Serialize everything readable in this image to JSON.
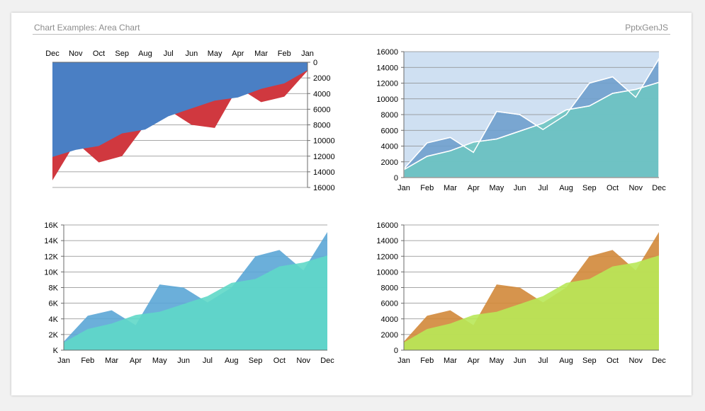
{
  "header": {
    "title": "Chart Examples: Area Chart",
    "brand": "PptxGenJS"
  },
  "chart_data": [
    {
      "type": "area",
      "categories": [
        "Jan",
        "Feb",
        "Mar",
        "Apr",
        "May",
        "Jun",
        "Jul",
        "Aug",
        "Sep",
        "Oct",
        "Nov",
        "Dec"
      ],
      "series": [
        {
          "color": "#d0383f",
          "values": [
            1100,
            4400,
            5100,
            3200,
            8400,
            8000,
            6100,
            8000,
            12000,
            12800,
            10200,
            15100
          ]
        },
        {
          "color": "#4a7fc4",
          "values": [
            1000,
            2700,
            3400,
            4500,
            4900,
            5900,
            6900,
            8600,
            9100,
            10700,
            11200,
            12100
          ]
        }
      ],
      "ylim": [
        0,
        16000
      ],
      "yticks": [
        "0",
        "2000",
        "4000",
        "6000",
        "8000",
        "10000",
        "12000",
        "14000",
        "16000"
      ],
      "x_reversed": true,
      "y_reversed": true,
      "x_axis_position": "top",
      "y_axis_position": "right",
      "grid": true,
      "plot_background": "#ffffff"
    },
    {
      "type": "area",
      "categories": [
        "Jan",
        "Feb",
        "Mar",
        "Apr",
        "May",
        "Jun",
        "Jul",
        "Aug",
        "Sep",
        "Oct",
        "Nov",
        "Dec"
      ],
      "series": [
        {
          "color": "#6fa0cd",
          "values": [
            1100,
            4400,
            5100,
            3200,
            8400,
            8000,
            6100,
            8000,
            12000,
            12800,
            10200,
            15100
          ]
        },
        {
          "color": "#6ec5c2",
          "values": [
            1000,
            2700,
            3400,
            4500,
            4900,
            5900,
            6900,
            8600,
            9100,
            10700,
            11200,
            12100
          ]
        }
      ],
      "ylim": [
        0,
        16000
      ],
      "yticks": [
        "0",
        "2000",
        "4000",
        "6000",
        "8000",
        "10000",
        "12000",
        "14000",
        "16000"
      ],
      "x_reversed": false,
      "y_reversed": false,
      "x_axis_position": "bottom",
      "y_axis_position": "left",
      "grid": true,
      "plot_background": "#cfe0f2"
    },
    {
      "type": "area",
      "categories": [
        "Jan",
        "Feb",
        "Mar",
        "Apr",
        "May",
        "Jun",
        "Jul",
        "Aug",
        "Sep",
        "Oct",
        "Nov",
        "Dec"
      ],
      "series": [
        {
          "color": "#5ba6d6",
          "values": [
            1100,
            4400,
            5100,
            3200,
            8400,
            8000,
            6100,
            8000,
            12000,
            12800,
            10200,
            15100
          ]
        },
        {
          "color": "#5fd8c8",
          "values": [
            1000,
            2700,
            3400,
            4500,
            4900,
            5900,
            6900,
            8600,
            9100,
            10700,
            11200,
            12100
          ]
        }
      ],
      "ylim": [
        0,
        16000
      ],
      "yticks": [
        "K",
        "2K",
        "4K",
        "6K",
        "8K",
        "10K",
        "12K",
        "14K",
        "16K"
      ],
      "x_reversed": false,
      "y_reversed": false,
      "x_axis_position": "bottom",
      "y_axis_position": "left",
      "grid": true,
      "plot_background": "#ffffff"
    },
    {
      "type": "area",
      "categories": [
        "Jan",
        "Feb",
        "Mar",
        "Apr",
        "May",
        "Jun",
        "Jul",
        "Aug",
        "Sep",
        "Oct",
        "Nov",
        "Dec"
      ],
      "series": [
        {
          "color": "#d1883a",
          "values": [
            1100,
            4400,
            5100,
            3200,
            8400,
            8000,
            6100,
            8000,
            12000,
            12800,
            10200,
            15100
          ]
        },
        {
          "color": "#b8e858",
          "values": [
            1000,
            2700,
            3400,
            4500,
            4900,
            5900,
            6900,
            8600,
            9100,
            10700,
            11200,
            12100
          ]
        }
      ],
      "ylim": [
        0,
        16000
      ],
      "yticks": [
        "0",
        "2000",
        "4000",
        "6000",
        "8000",
        "10000",
        "12000",
        "14000",
        "16000"
      ],
      "x_reversed": false,
      "y_reversed": false,
      "x_axis_position": "bottom",
      "y_axis_position": "left",
      "grid": true,
      "plot_background": "#ffffff"
    }
  ]
}
